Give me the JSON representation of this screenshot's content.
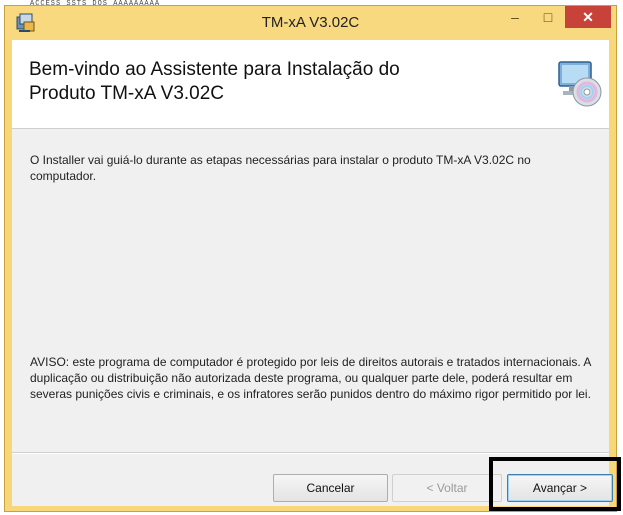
{
  "window": {
    "title": "TM-xA V3.02C",
    "controls": {
      "minimize": "–",
      "maximize": "□",
      "close": "✕"
    }
  },
  "background_text": "ACCESS_SSTS DOS     AAAAAAAAA",
  "header": {
    "heading_line1": "Bem-vindo ao Assistente para Instalação do",
    "heading_line2": "Produto TM-xA V3.02C",
    "icon": "setup-cd-computer-icon"
  },
  "body": {
    "intro": "O Installer vai guiá-lo durante as etapas necessárias para instalar o produto TM-xA V3.02C no computador.",
    "warning": "AVISO: este programa de computador é protegido por leis de direitos autorais e tratados internacionais. A duplicação ou distribuição não autorizada deste programa, ou qualquer parte dele, poderá resultar em severas punições civis e criminais, e os infratores serão punidos dentro do máximo rigor permitido por lei."
  },
  "buttons": {
    "cancel": "Cancelar",
    "back": "< Voltar",
    "next": "Avançar >"
  },
  "colors": {
    "titlebar": "#f9d97f",
    "close": "#c7433a",
    "highlight": "#000000"
  }
}
